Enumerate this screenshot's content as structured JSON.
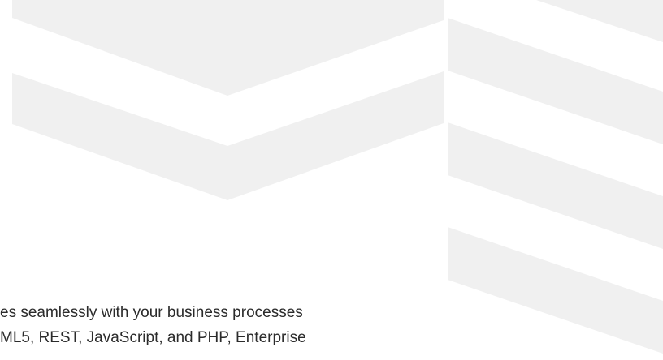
{
  "colors": {
    "background": "#ffffff",
    "shape_fill": "#f0f0f0",
    "text": "#2b2b2b"
  },
  "body_text": {
    "line1": "es seamlessly with your business processes",
    "line2": "ML5, REST, JavaScript, and PHP, Enterprise"
  }
}
